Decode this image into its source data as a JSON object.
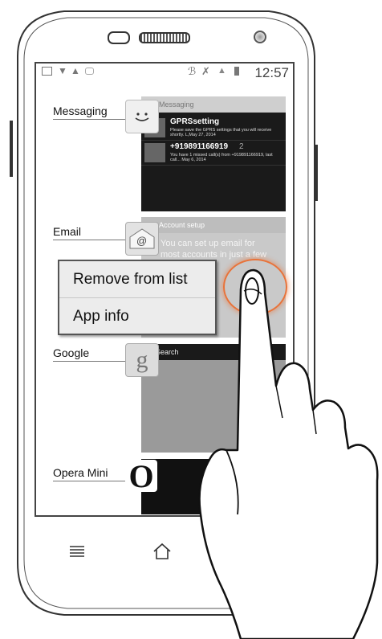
{
  "status_bar": {
    "clock": "12:57"
  },
  "apps": [
    {
      "label": "Messaging",
      "icon": "smiley-message-icon"
    },
    {
      "label": "Email",
      "icon": "email-at-icon",
      "thumb_header": "Account setup",
      "thumb_text": "You can set up email for most accounts in just a few steps."
    },
    {
      "label": "Google",
      "icon": "google-g-icon",
      "thumb_header": "Search"
    },
    {
      "label": "Opera Mini",
      "icon": "opera-o-icon"
    }
  ],
  "messaging_thumb": {
    "header": "Messaging",
    "rows": [
      {
        "title": "GPRSsetting",
        "body": "Please save the GPRS settings that you will receive shortly. L,May 27, 2014"
      },
      {
        "title": "+919891166919",
        "count": "2",
        "body": "You have 1 missed call(s) from +919891166919, last call...   May 6, 2014"
      }
    ]
  },
  "context_menu": {
    "items": [
      "Remove from list",
      "App info"
    ]
  },
  "colors": {
    "menu_bg": "#ececec",
    "touch_ring": "#e8733a",
    "thumb_dark": "#1a1a1a"
  }
}
